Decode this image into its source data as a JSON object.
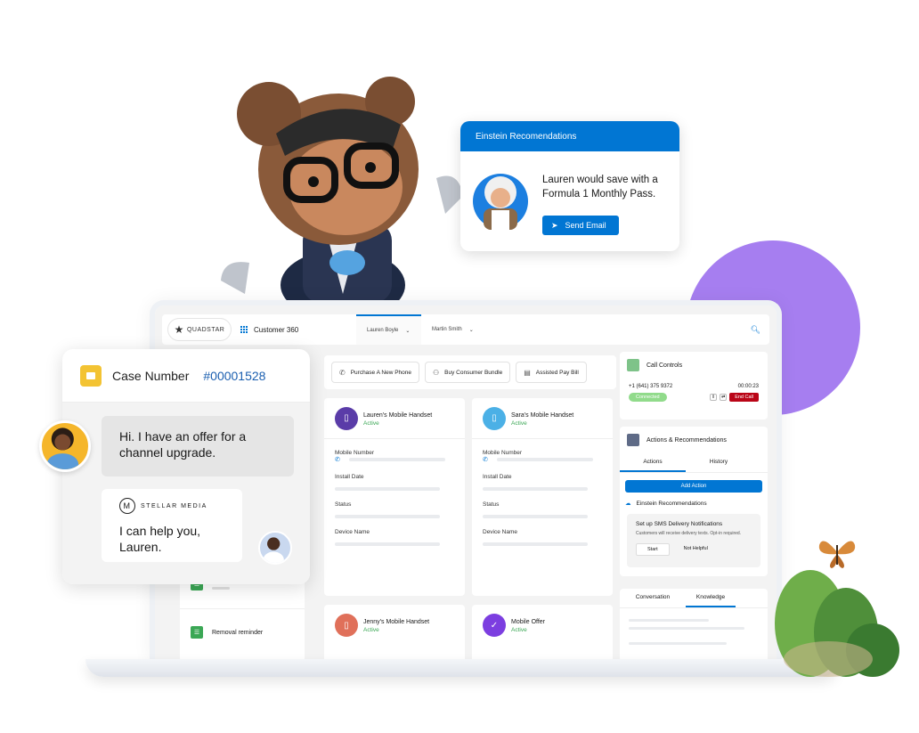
{
  "einstein": {
    "title": "Einstein Recomendations",
    "message": "Lauren would save with a Formula 1 Monthly Pass.",
    "send_label": "Send Email"
  },
  "app": {
    "logo": "QUADSTAR",
    "app_name": "Customer 360",
    "tabs": [
      {
        "label": "Lauren Boyle"
      },
      {
        "label": "Martin Smith"
      }
    ]
  },
  "quick_actions": [
    {
      "label": "Purchase A New Phone",
      "icon": "phone-icon"
    },
    {
      "label": "Buy Consumer Bundle",
      "icon": "people-icon"
    },
    {
      "label": "Assisted Pay Bill",
      "icon": "bill-icon"
    }
  ],
  "devices": [
    {
      "title": "Lauren's Mobile Handset",
      "status": "Active",
      "color": "#5a3ca8",
      "icon": "phone-icon"
    },
    {
      "title": "Sara's Mobile Handset",
      "status": "Active",
      "color": "#4bb0e6",
      "icon": "phone-icon"
    },
    {
      "title": "Jenny's Mobile Handset",
      "status": "Active",
      "color": "#e0705a",
      "icon": "phone-icon"
    },
    {
      "title": "Mobile Offer",
      "status": "Active",
      "color": "#7c3ee0",
      "icon": "offer-icon"
    }
  ],
  "device_fields": {
    "mobile_number": "Mobile Number",
    "install_date": "Install Date",
    "status": "Status",
    "device_name": "Device Name"
  },
  "call_controls": {
    "title": "Call Controls",
    "phone": "+1 (641) 375 9372",
    "timer": "00:00:23",
    "status": "Connected",
    "end_label": "End Call"
  },
  "actions_card": {
    "title": "Actions & Recommendations",
    "tabs": [
      "Actions",
      "History"
    ],
    "add_label": "Add Action",
    "einstein_label": "Einstein Recommendations",
    "rec_title": "Set up SMS Delivery Notifications",
    "rec_sub": "Customers will receive delivery texts. Opt-in required.",
    "start_label": "Start",
    "not_helpful_label": "Not Helpful"
  },
  "conversation_card": {
    "tabs": [
      "Conversation",
      "Knowledge"
    ]
  },
  "left_list": {
    "removal": "Removal reminder"
  },
  "case": {
    "label": "Case Number",
    "number": "#00001528",
    "customer_message": "Hi. I have an offer for a channel upgrade.",
    "agent_company": "STELLAR MEDIA",
    "agent_message": "I can help you, Lauren."
  }
}
